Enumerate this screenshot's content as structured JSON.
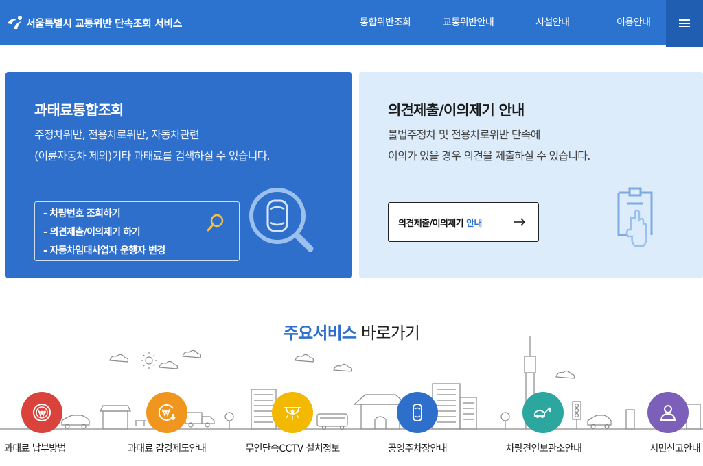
{
  "header": {
    "title": "서울특별시 교통위반 단속조회 서비스",
    "nav": [
      "통합위반조회",
      "교통위반안내",
      "시설안내",
      "이용안내"
    ],
    "menu_icon": "hamburger-icon"
  },
  "card_left": {
    "title": "과태료통합조회",
    "desc_line1": "주정차위반, 전용차로위반, 자동차관련",
    "desc_line2": "(이륜자동차 제외)기타 과태료를 검색하실 수 있습니다.",
    "links": [
      "- 차량번호 조회하기",
      "- 의견제출/이의제기 하기",
      "- 자동차임대사업자 운행자 변경"
    ]
  },
  "card_right": {
    "title": "의견제출/이의제기 안내",
    "desc_line1": "불법주정차 및 전용차로위반 단속에",
    "desc_line2": "이의가 있을 경우 의견을 제출하실 수 있습니다.",
    "button_label": "의견제출/이의제기",
    "button_accent": "안내"
  },
  "services": {
    "title_accent": "주요서비스",
    "title_rest": " 바로가기",
    "items": [
      {
        "label": "과태료 납부방법",
        "color": "#d9433c",
        "icon": "won-coin-icon"
      },
      {
        "label": "과태료 감경제도안내",
        "color": "#f0961e",
        "icon": "won-discount-icon"
      },
      {
        "label": "무인단속CCTV 설치정보",
        "color": "#f3b800",
        "icon": "cctv-icon"
      },
      {
        "label": "공영주차장안내",
        "color": "#2e6fcb",
        "icon": "parking-car-icon"
      },
      {
        "label": "차량견인보관소안내",
        "color": "#2ba7a0",
        "icon": "tow-truck-icon"
      },
      {
        "label": "시민신고안내",
        "color": "#7b5fb8",
        "icon": "person-icon"
      }
    ]
  },
  "colors": {
    "header_bg": "#2b73cf",
    "menu_bg": "#1f5eb0",
    "card_left_bg": "#2e6fcb",
    "card_right_bg": "#dcecfb",
    "accent": "#2e6fcb"
  }
}
